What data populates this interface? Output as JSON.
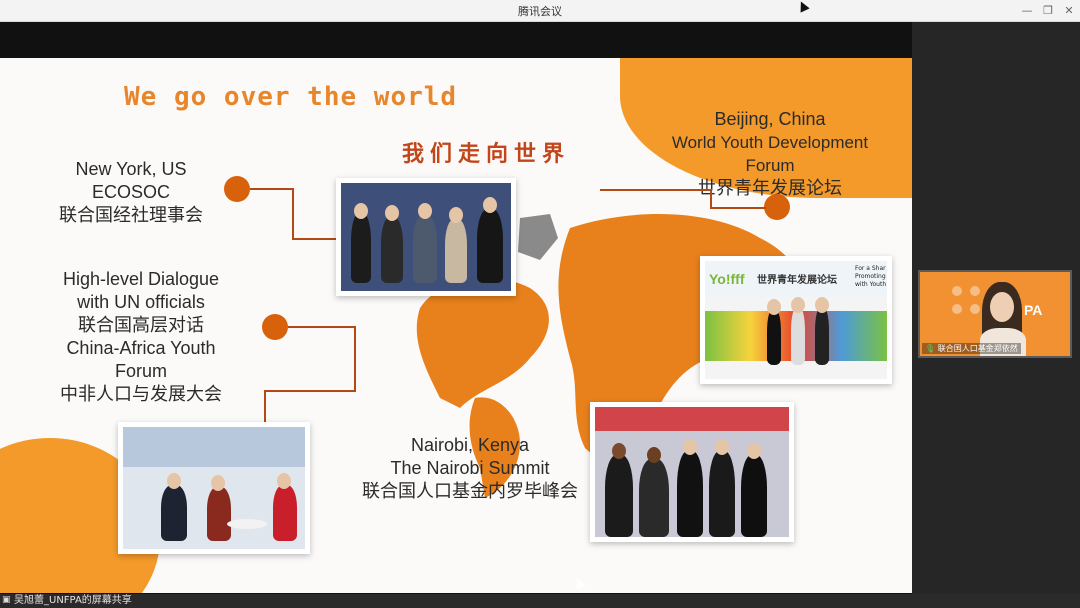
{
  "app": {
    "title": "腾讯会议",
    "window_controls": [
      "—",
      "❐",
      "✕"
    ]
  },
  "slide": {
    "heading_en": "We go over the world",
    "heading_cn": "我们走向世界",
    "newyork": {
      "line1": "New York, US",
      "line2": "ECOSOC",
      "line3": "联合国经社理事会"
    },
    "dialogue": {
      "line1": "High-level Dialogue",
      "line2": "with UN officials",
      "line3": "联合国高层对话",
      "line4": "China-Africa Youth",
      "line5": "Forum",
      "line6": "中非人口与发展大会"
    },
    "beijing": {
      "line1": "Beijing, China",
      "line2": "World Youth Development",
      "line3": "Forum",
      "line4": "世界青年发展论坛"
    },
    "nairobi": {
      "line1": "Nairobi, Kenya",
      "line2": "The Nairobi Summit",
      "line3": "联合国人口基金内罗毕峰会"
    },
    "forum_banner": "世界青年发展论坛",
    "forum_logo": "Yo!fff",
    "forum_side": "For a Shar Promoting with Youth",
    "accent_color": "#f39a2a"
  },
  "video": {
    "participant_name": "联合国人口基金郑依然",
    "badge": "PA"
  },
  "status": {
    "share_text": "吴旭蕾_UNFPA的屏幕共享"
  }
}
